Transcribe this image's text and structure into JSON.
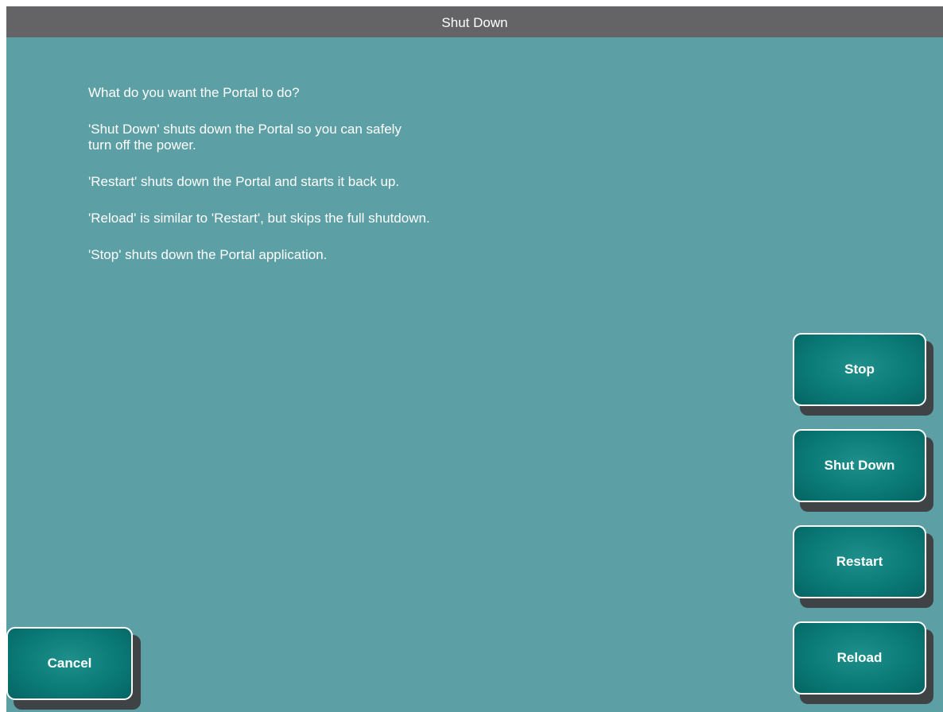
{
  "window": {
    "title": "Shut Down"
  },
  "message": {
    "lines": [
      "What do you want the Portal to do?",
      "'Shut Down' shuts down the Portal so you can safely\nturn off the power.",
      "'Restart' shuts down the Portal and starts it back up.",
      "'Reload' is similar to 'Restart', but skips the full shutdown.",
      "'Stop' shuts down the Portal application."
    ]
  },
  "buttons": {
    "stop": "Stop",
    "shut_down": "Shut Down",
    "restart": "Restart",
    "reload": "Reload",
    "cancel": "Cancel"
  },
  "colors": {
    "background": "#5c9fa5",
    "titlebar": "#646366",
    "button_fill": "#0b7b78",
    "button_border": "#ffffff",
    "button_shadow": "#3f4345",
    "text": "#ffffff"
  }
}
